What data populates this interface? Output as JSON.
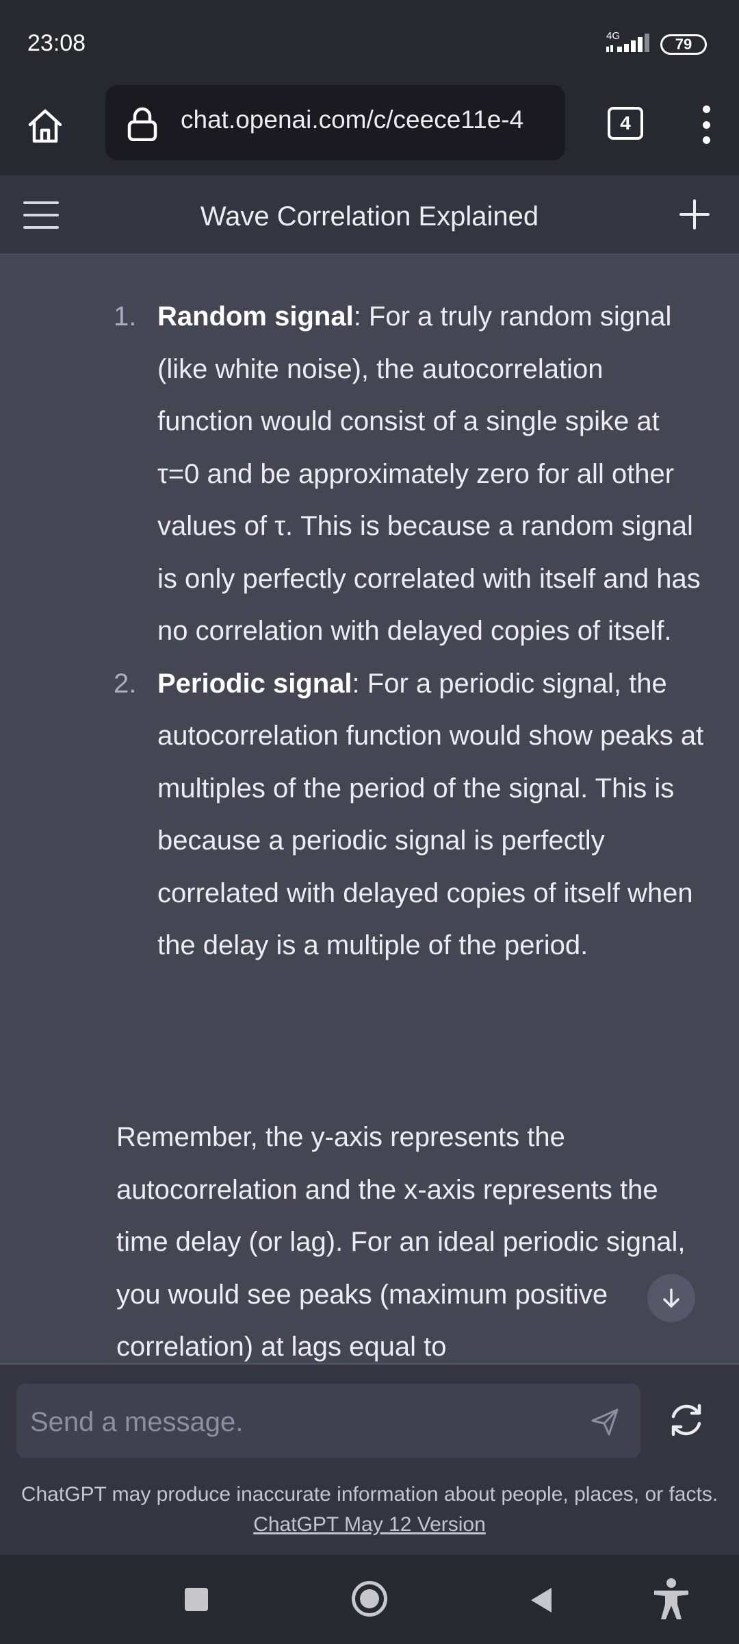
{
  "status_bar": {
    "time": "23:08",
    "network": "4G",
    "battery": "79"
  },
  "browser": {
    "url": "chat.openai.com/c/ceece11e-4",
    "tab_count": "4",
    "icons": [
      "home-icon",
      "lock-icon",
      "more-vert-icon"
    ]
  },
  "chat": {
    "title": "Wave Correlation Explained",
    "icons": [
      "menu-icon",
      "plus-icon"
    ]
  },
  "message": {
    "items": [
      {
        "number": "1.",
        "term": "Random signal",
        "text": ": For a truly random signal (like white noise), the autocorrelation function would consist of a single spike at τ=0 and be approximately zero for all other values of τ. This is because a random signal is only perfectly correlated with itself and has no correlation with delayed copies of itself."
      },
      {
        "number": "2.",
        "term": "Periodic signal",
        "text": ": For a periodic signal, the autocorrelation function would show peaks at multiples of the period of the signal. This is because a periodic signal is perfectly correlated with delayed copies of itself when the delay is a multiple of the period."
      }
    ],
    "paragraph": "Remember, the y-axis represents the autocorrelation and the x-axis represents the time delay (or lag). For an ideal periodic signal, you would see peaks (maximum positive correlation) at lags equal to"
  },
  "composer": {
    "placeholder": "Send a message.",
    "disclaimer": "ChatGPT may produce inaccurate information about people, places, or facts.",
    "version_link": "ChatGPT May 12 Version"
  },
  "colors": {
    "background": "#444654",
    "header": "#343541",
    "system_bar": "#282830",
    "text": "#ececf1"
  }
}
